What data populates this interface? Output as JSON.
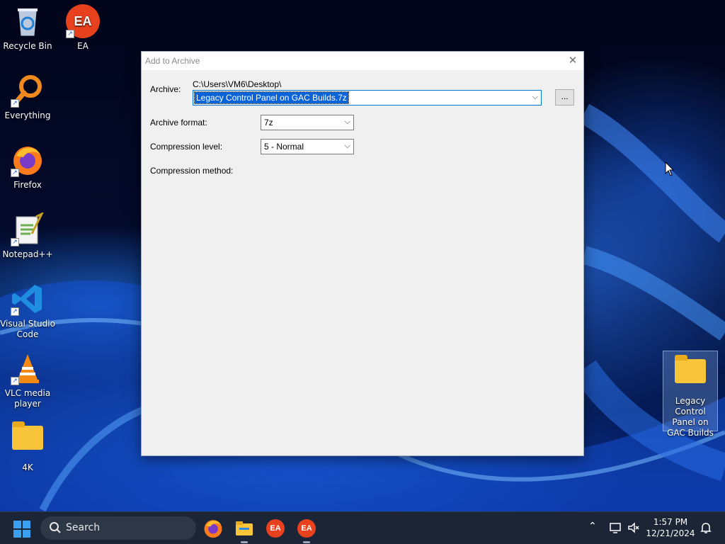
{
  "desktop": {
    "icons": [
      {
        "label": "Recycle Bin",
        "icon": "recycle-bin-icon"
      },
      {
        "label": "EA",
        "icon": "ea-icon"
      },
      {
        "label": "Everything",
        "icon": "everything-search-icon"
      },
      {
        "label": "Firefox",
        "icon": "firefox-icon"
      },
      {
        "label": "Notepad++",
        "icon": "notepad-plus-plus-icon"
      },
      {
        "label": "Visual Studio Code",
        "icon": "vscode-icon"
      },
      {
        "label": "VLC media player",
        "icon": "vlc-icon"
      },
      {
        "label": "4K",
        "icon": "folder-icon"
      },
      {
        "label": "Legacy Control Panel on GAC Builds",
        "icon": "folder-icon"
      }
    ]
  },
  "dialog": {
    "title": "Add to Archive",
    "close_glyph": "✕",
    "archive_label": "Archive:",
    "archive_path": "C:\\Users\\VM6\\Desktop\\",
    "archive_name": "Legacy Control Panel on GAC Builds.7z",
    "browse_label": "...",
    "format_label": "Archive format:",
    "format_value": "7z",
    "level_label": "Compression level:",
    "level_value": "5 - Normal",
    "method_label": "Compression method:"
  },
  "taskbar": {
    "search_label": "Search",
    "apps": [
      "firefox-icon",
      "file-explorer-icon",
      "ea-icon",
      "ea-icon"
    ],
    "ea_text": "EA",
    "time": "1:57 PM",
    "date": "12/21/2024"
  },
  "colors": {
    "accent": "#0078d7",
    "selection": "#0a64d8",
    "taskbar": "#1c2535"
  }
}
